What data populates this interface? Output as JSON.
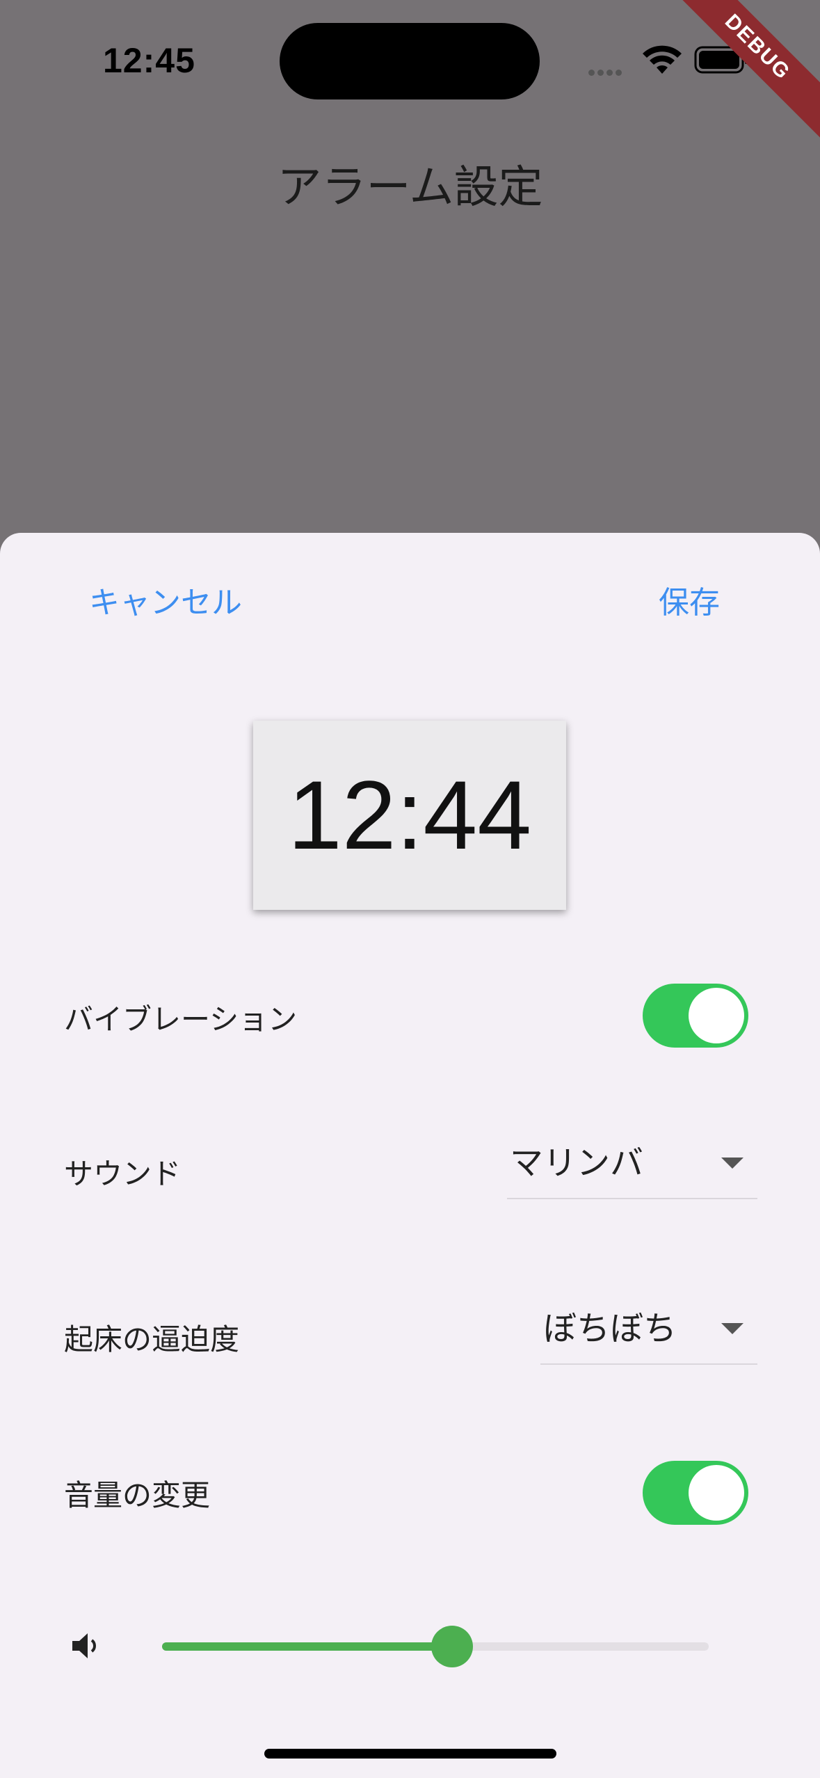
{
  "status_bar": {
    "time": "12:45",
    "debug_label": "DEBUG"
  },
  "page": {
    "title": "アラーム設定"
  },
  "sheet": {
    "cancel_label": "キャンセル",
    "save_label": "保存",
    "alarm_time": "12:44",
    "vibration": {
      "label": "バイブレーション",
      "enabled": true
    },
    "sound": {
      "label": "サウンド",
      "value": "マリンバ"
    },
    "urgency": {
      "label": "起床の逼迫度",
      "value": "ぼちぼち"
    },
    "volume_change": {
      "label": "音量の変更",
      "enabled": true
    },
    "volume": {
      "level": 0.53
    }
  },
  "colors": {
    "accent_blue": "#3d8ef0",
    "toggle_on": "#34c759",
    "slider_green": "#4caf50",
    "backdrop": "#767275",
    "sheet_bg": "#f4f0f6"
  },
  "icons": {
    "wifi": "wifi-icon",
    "battery": "battery-icon",
    "volume": "speaker-icon",
    "dropdown": "caret-down-icon"
  }
}
